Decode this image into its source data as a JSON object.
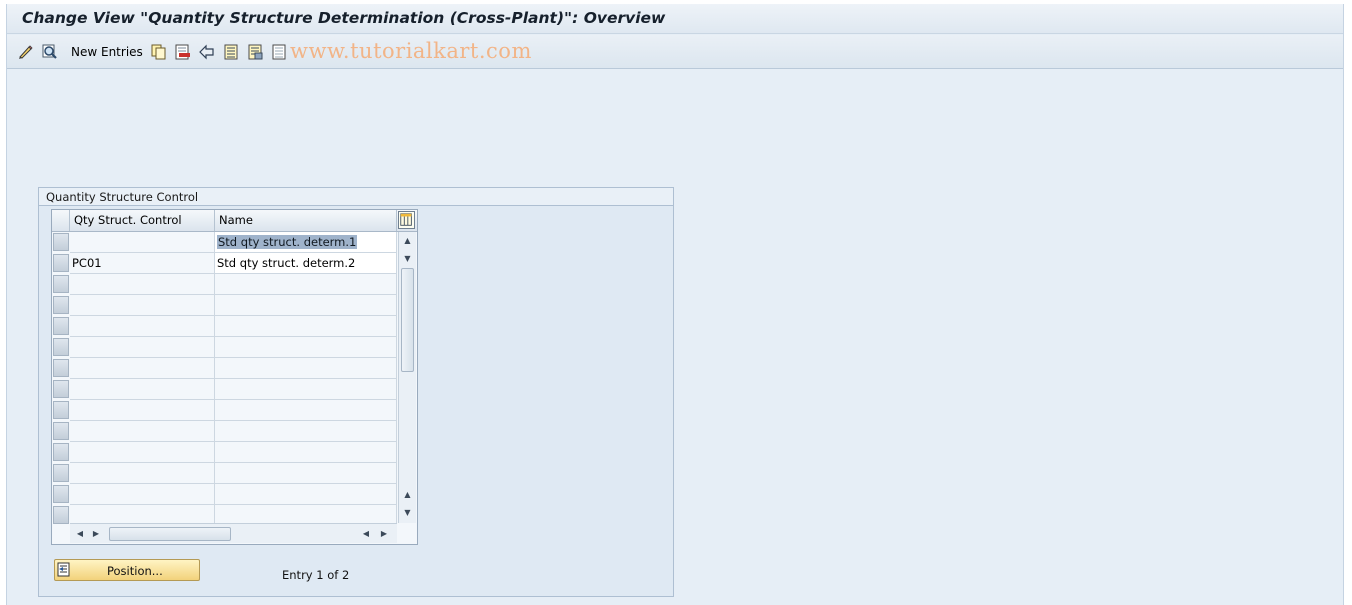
{
  "window": {
    "title": "Change View \"Quantity Structure Determination (Cross-Plant)\": Overview"
  },
  "toolbar": {
    "new_entries_label": "New Entries",
    "watermark": "www.tutorialkart.com",
    "icons": [
      "display-change-icon",
      "other-view-icon",
      "copy-icon",
      "delete-icon",
      "undo-icon",
      "select-all-icon",
      "select-block-icon",
      "deselect-all-icon"
    ]
  },
  "group": {
    "title": "Quantity Structure Control"
  },
  "table": {
    "columns": [
      "Qty Struct. Control",
      "Name"
    ],
    "rows": [
      {
        "control": "",
        "name": "Std qty struct. determ.1"
      },
      {
        "control": "PC01",
        "name": "Std qty struct. determ.2"
      }
    ],
    "empty_rows": 12
  },
  "footer": {
    "position_label": "Position...",
    "entry_info": "Entry 1 of 2"
  },
  "colors": {
    "window_bg": "#e6eef6",
    "button_bg": "#f2d27b",
    "selection": "#9fb3cb",
    "watermark": "#f2b487"
  }
}
